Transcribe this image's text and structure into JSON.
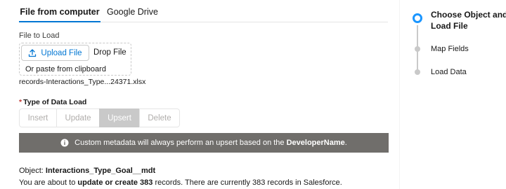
{
  "tabs": [
    {
      "label": "File from computer",
      "active": true
    },
    {
      "label": "Google Drive",
      "active": false
    }
  ],
  "upload": {
    "field_label": "File to Load",
    "button_label": "Upload File",
    "drop_text": "Drop File",
    "paste_text": "Or paste from clipboard",
    "file_name": "records-Interactions_Type...24371.xlsx"
  },
  "data_load": {
    "required_mark": "*",
    "label": "Type of Data Load",
    "options": [
      "Insert",
      "Update",
      "Upsert",
      "Delete"
    ],
    "selected": "Upsert"
  },
  "banner": {
    "text_before": "Custom metadata will always perform an upsert based on the ",
    "bold": "DeveloperName",
    "text_after": "."
  },
  "summary": {
    "object_prefix": "Object: ",
    "object_name": "Interactions_Type_Goal__mdt",
    "records_prefix": "You are about to ",
    "records_bold": "update or create 383",
    "records_suffix": " records. There are currently 383 records in Salesforce."
  },
  "steps": [
    {
      "label": "Choose Object and Load File",
      "active": true
    },
    {
      "label": "Map Fields",
      "active": false
    },
    {
      "label": "Load Data",
      "active": false
    }
  ],
  "colors": {
    "accent": "#0176d3",
    "step_active": "#1b96ff",
    "banner_bg": "#706e6b",
    "selected_bg": "#c9c9c9",
    "required": "#c23934"
  },
  "icons": {
    "upload": "upload-icon",
    "info": "info-icon"
  }
}
